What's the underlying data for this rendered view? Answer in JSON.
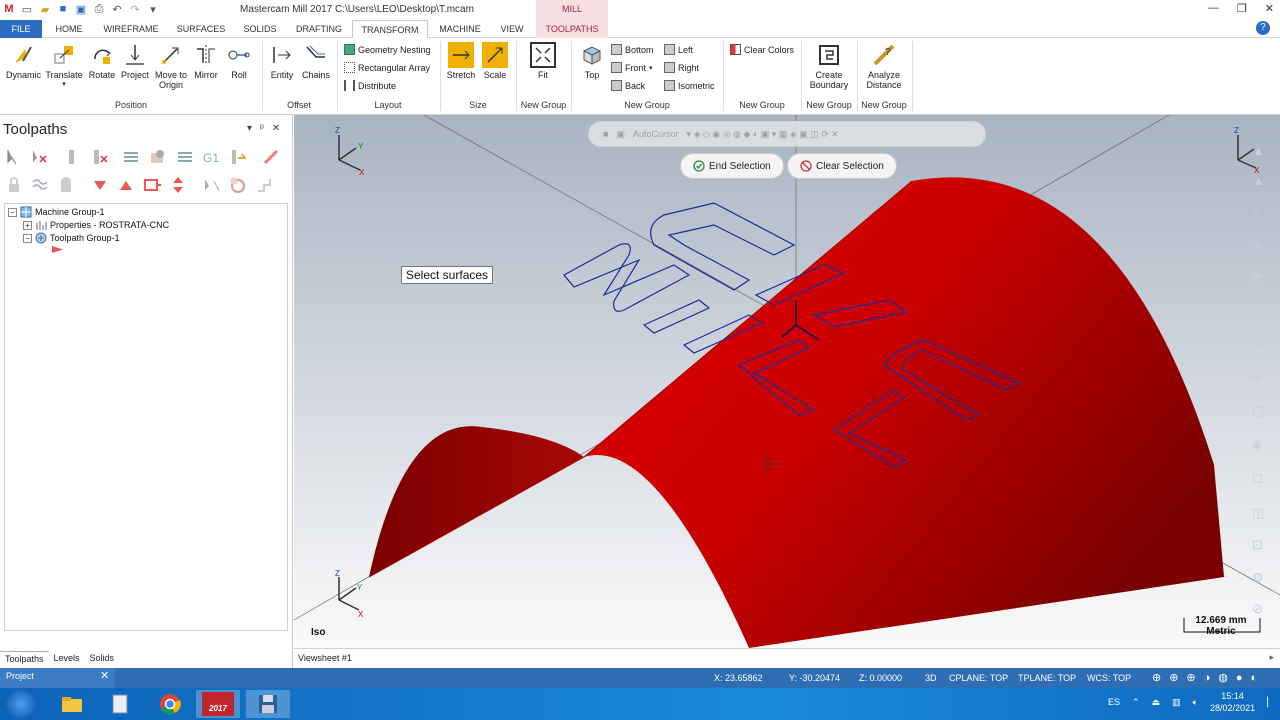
{
  "title_bar": {
    "app_title": "Mastercam Mill 2017  C:\\Users\\LEO\\Desktop\\T.mcam",
    "context_label": "MILL"
  },
  "tabs": [
    {
      "label": "FILE"
    },
    {
      "label": "HOME"
    },
    {
      "label": "WIREFRAME"
    },
    {
      "label": "SURFACES"
    },
    {
      "label": "SOLIDS"
    },
    {
      "label": "DRAFTING"
    },
    {
      "label": "TRANSFORM"
    },
    {
      "label": "MACHINE"
    },
    {
      "label": "VIEW"
    },
    {
      "label": "TOOLPATHS"
    }
  ],
  "active_tab": "TRANSFORM",
  "ribbon": {
    "position": {
      "buttons": [
        "Dynamic",
        "Translate",
        "Rotate",
        "Project",
        "Move to Origin",
        "Mirror",
        "Roll"
      ],
      "group": "Position"
    },
    "offset": {
      "buttons": [
        "Entity",
        "Chains"
      ],
      "group": "Offset"
    },
    "layout": {
      "items": [
        "Geometry Nesting",
        "Rectangular Array",
        "Distribute"
      ],
      "group": "Layout"
    },
    "size": {
      "buttons": [
        "Stretch",
        "Scale"
      ],
      "group": "Size"
    },
    "fit": {
      "button": "Fit",
      "group": "New Group"
    },
    "views": {
      "top_button": "Top",
      "items": [
        "Bottom",
        "Front",
        "Back",
        "Left",
        "Right",
        "Isometric"
      ],
      "group": "New Group"
    },
    "clear": {
      "item": "Clear Colors",
      "group": "New Group"
    },
    "boundary": {
      "button": "Create Boundary",
      "group": "New Group"
    },
    "analyze": {
      "button": "Analyze Distance",
      "group": "New Group"
    }
  },
  "left_panel": {
    "title": "Toolpaths",
    "tree": [
      {
        "label": "Machine Group-1"
      },
      {
        "label": "Properties - ROSTRATA-CNC"
      },
      {
        "label": "Toolpath Group-1"
      }
    ],
    "bottom_tabs": [
      "Toolpaths",
      "Levels",
      "Solids"
    ]
  },
  "viewport": {
    "end_selection": "End Selection",
    "clear_selection": "Clear Selection",
    "autocursor": "AutoCursor",
    "prompt": "Select surfaces",
    "view_name": "Iso",
    "scale_value": "12.669 mm",
    "scale_unit": "Metric",
    "viewsheet": "Viewsheet #1",
    "surface_color": "#c80000"
  },
  "status_bar": {
    "project": "Project",
    "x": "X:  23.65862",
    "y": "Y:  -30.20474",
    "z": "Z:  0.00000",
    "mode": "3D",
    "cplane": "CPLANE: TOP",
    "tplane": "TPLANE: TOP",
    "wcs": "WCS: TOP"
  },
  "taskbar": {
    "lang": "ES",
    "time": "15:14",
    "date": "28/02/2021",
    "mastercam_badge": "2017"
  }
}
